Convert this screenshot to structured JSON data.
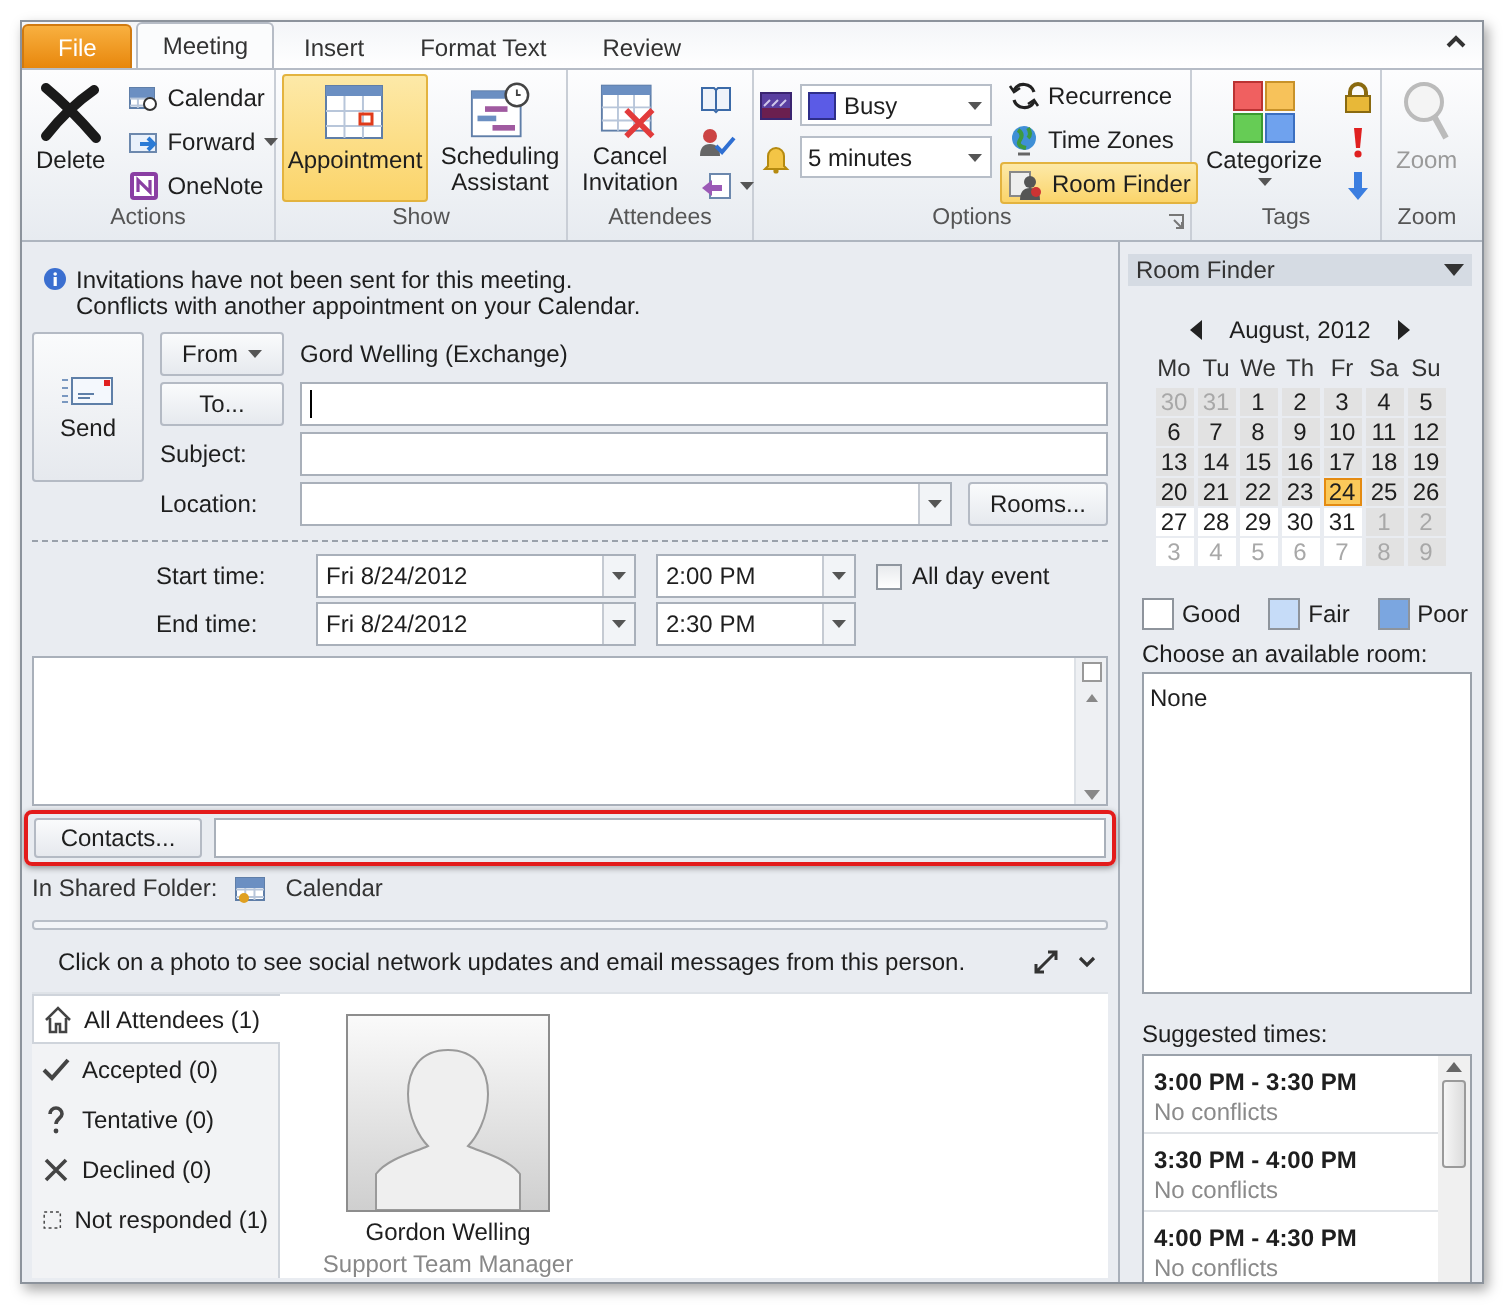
{
  "tabs": [
    {
      "label": "File",
      "kind": "file",
      "selected": false
    },
    {
      "label": "Meeting",
      "kind": "tab",
      "selected": true
    },
    {
      "label": "Insert",
      "kind": "tab",
      "selected": false
    },
    {
      "label": "Format Text",
      "kind": "tab",
      "selected": false
    },
    {
      "label": "Review",
      "kind": "tab",
      "selected": false
    }
  ],
  "ribbon": {
    "actions": {
      "label": "Actions",
      "delete": "Delete",
      "calendar": "Calendar",
      "forward": "Forward",
      "onenote": "OneNote"
    },
    "show": {
      "label": "Show",
      "buttons": [
        {
          "label": "Appointment",
          "kind": "appointment",
          "selected": true
        },
        {
          "label": "Scheduling Assistant",
          "kind": "scheduling",
          "selected": false
        }
      ]
    },
    "attendees": {
      "label": "Attendees",
      "cancel": "Cancel Invitation"
    },
    "options": {
      "label": "Options",
      "show_as": "Busy",
      "reminder": "5 minutes",
      "recurrence": "Recurrence",
      "time_zones": "Time Zones",
      "room_finder": {
        "label": "Room Finder",
        "on": true
      }
    },
    "tags": {
      "label": "Tags",
      "categorize": "Categorize"
    },
    "zoom": {
      "label": "Zoom",
      "button": {
        "label": "Zoom",
        "disabled": true
      }
    }
  },
  "info": [
    "Invitations have not been sent for this meeting.",
    "Conflicts with another appointment on your Calendar."
  ],
  "send": "Send",
  "from": {
    "button": "From",
    "value": "Gord Welling (Exchange)"
  },
  "to": {
    "button": "To..."
  },
  "subject": {
    "label": "Subject:"
  },
  "location": {
    "label": "Location:",
    "button": "Rooms..."
  },
  "start": {
    "label": "Start time:",
    "date": "Fri 8/24/2012",
    "time": "2:00 PM"
  },
  "end": {
    "label": "End time:",
    "date": "Fri 8/24/2012",
    "time": "2:30 PM"
  },
  "all_day": {
    "label": "All day event",
    "checked": false
  },
  "contacts": {
    "button": "Contacts...",
    "highlighted": true
  },
  "shared_folder": {
    "label": "In Shared Folder:",
    "value": "Calendar"
  },
  "people_pane": {
    "message": "Click on a photo to see social network updates and email messages from this person.",
    "filters": [
      {
        "label": "All Attendees (1)",
        "kind": "all",
        "selected": true
      },
      {
        "label": "Accepted (0)",
        "kind": "accepted",
        "selected": false
      },
      {
        "label": "Tentative (0)",
        "kind": "tentative",
        "selected": false
      },
      {
        "label": "Declined (0)",
        "kind": "declined",
        "selected": false
      },
      {
        "label": "Not responded (1)",
        "kind": "not_responded",
        "selected": false
      }
    ],
    "people": [
      {
        "name": "Gordon Welling",
        "title": "Support Team Manager"
      }
    ]
  },
  "room_finder": {
    "title": "Room Finder",
    "month": "August, 2012",
    "weekdays": [
      "Mo",
      "Tu",
      "We",
      "Th",
      "Fr",
      "Sa",
      "Su"
    ],
    "weeks": [
      [
        {
          "day": "30",
          "other_month": true,
          "shaded": true,
          "selected": false
        },
        {
          "day": "31",
          "other_month": true,
          "shaded": true,
          "selected": false
        },
        {
          "day": "1",
          "other_month": false,
          "shaded": true,
          "selected": false
        },
        {
          "day": "2",
          "other_month": false,
          "shaded": true,
          "selected": false
        },
        {
          "day": "3",
          "other_month": false,
          "shaded": true,
          "selected": false
        },
        {
          "day": "4",
          "other_month": false,
          "shaded": true,
          "selected": false
        },
        {
          "day": "5",
          "other_month": false,
          "shaded": true,
          "selected": false
        }
      ],
      [
        {
          "day": "6",
          "other_month": false,
          "shaded": true,
          "selected": false
        },
        {
          "day": "7",
          "other_month": false,
          "shaded": true,
          "selected": false
        },
        {
          "day": "8",
          "other_month": false,
          "shaded": true,
          "selected": false
        },
        {
          "day": "9",
          "other_month": false,
          "shaded": true,
          "selected": false
        },
        {
          "day": "10",
          "other_month": false,
          "shaded": true,
          "selected": false
        },
        {
          "day": "11",
          "other_month": false,
          "shaded": true,
          "selected": false
        },
        {
          "day": "12",
          "other_month": false,
          "shaded": true,
          "selected": false
        }
      ],
      [
        {
          "day": "13",
          "other_month": false,
          "shaded": true,
          "selected": false
        },
        {
          "day": "14",
          "other_month": false,
          "shaded": true,
          "selected": false
        },
        {
          "day": "15",
          "other_month": false,
          "shaded": true,
          "selected": false
        },
        {
          "day": "16",
          "other_month": false,
          "shaded": true,
          "selected": false
        },
        {
          "day": "17",
          "other_month": false,
          "shaded": true,
          "selected": false
        },
        {
          "day": "18",
          "other_month": false,
          "shaded": true,
          "selected": false
        },
        {
          "day": "19",
          "other_month": false,
          "shaded": true,
          "selected": false
        }
      ],
      [
        {
          "day": "20",
          "other_month": false,
          "shaded": true,
          "selected": false
        },
        {
          "day": "21",
          "other_month": false,
          "shaded": true,
          "selected": false
        },
        {
          "day": "22",
          "other_month": false,
          "shaded": true,
          "selected": false
        },
        {
          "day": "23",
          "other_month": false,
          "shaded": true,
          "selected": false
        },
        {
          "day": "24",
          "other_month": false,
          "shaded": true,
          "selected": true
        },
        {
          "day": "25",
          "other_month": false,
          "shaded": true,
          "selected": false
        },
        {
          "day": "26",
          "other_month": false,
          "shaded": true,
          "selected": false
        }
      ],
      [
        {
          "day": "27",
          "other_month": false,
          "shaded": false,
          "selected": false
        },
        {
          "day": "28",
          "other_month": false,
          "shaded": false,
          "selected": false
        },
        {
          "day": "29",
          "other_month": false,
          "shaded": false,
          "selected": false
        },
        {
          "day": "30",
          "other_month": false,
          "shaded": false,
          "selected": false
        },
        {
          "day": "31",
          "other_month": false,
          "shaded": false,
          "selected": false
        },
        {
          "day": "1",
          "other_month": true,
          "shaded": true,
          "selected": false
        },
        {
          "day": "2",
          "other_month": true,
          "shaded": true,
          "selected": false
        }
      ],
      [
        {
          "day": "3",
          "other_month": true,
          "shaded": false,
          "selected": false
        },
        {
          "day": "4",
          "other_month": true,
          "shaded": false,
          "selected": false
        },
        {
          "day": "5",
          "other_month": true,
          "shaded": false,
          "selected": false
        },
        {
          "day": "6",
          "other_month": true,
          "shaded": false,
          "selected": false
        },
        {
          "day": "7",
          "other_month": true,
          "shaded": false,
          "selected": false
        },
        {
          "day": "8",
          "other_month": true,
          "shaded": true,
          "selected": false
        },
        {
          "day": "9",
          "other_month": true,
          "shaded": true,
          "selected": false
        }
      ]
    ],
    "legend": [
      {
        "label": "Good",
        "color": "#ffffff"
      },
      {
        "label": "Fair",
        "color": "#c6dcf8"
      },
      {
        "label": "Poor",
        "color": "#7ba6e0"
      }
    ],
    "rooms_label": "Choose an available room:",
    "rooms": [
      "None"
    ],
    "suggested_label": "Suggested times:",
    "suggestions": [
      {
        "time": "3:00 PM - 3:30 PM",
        "status": "No conflicts"
      },
      {
        "time": "3:30 PM - 4:00 PM",
        "status": "No conflicts"
      },
      {
        "time": "4:00 PM - 4:30 PM",
        "status": "No conflicts"
      }
    ]
  }
}
